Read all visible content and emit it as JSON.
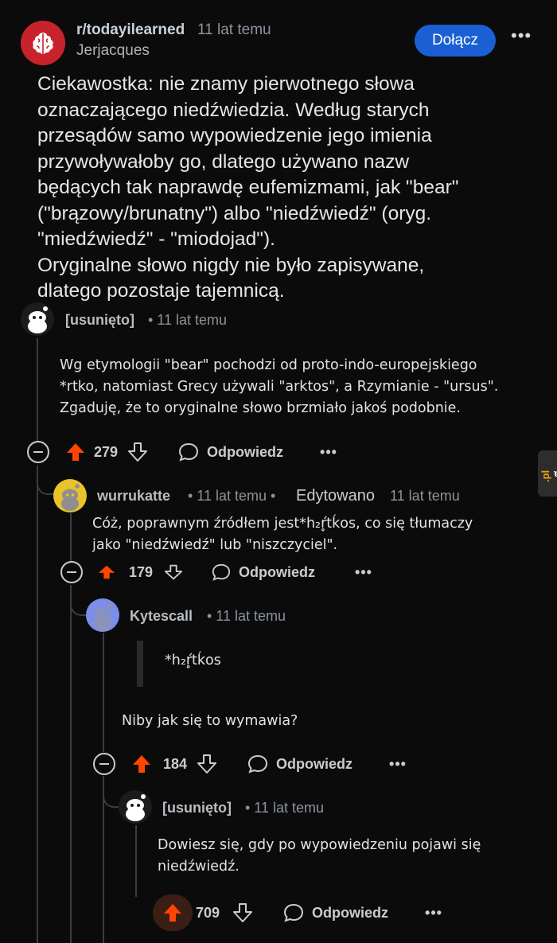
{
  "post": {
    "subreddit": "r/todayilearned",
    "time": "11 lat temu",
    "author": "Jerjacques",
    "join_label": "Dołącz",
    "more": "•••",
    "title": "Ciekawostka: nie znamy pierwotnego słowa\noznaczającego niedźwiedzia. Według starych\nprzesądów samo wypowiedzenie jego imienia\nprzywoływałoby go, dlatego używano nazw\nbędących tak naprawdę eufemizmami, jak \"bear\"\n(\"brązowy/brunatny\") albo \"niedźwiedź\" (oryg.\n\"miedźwiedź\" - \"miodojad\").\nOryginalne słowo nigdy nie było zapisywane,\ndlatego pozostaje tajemnicą."
  },
  "comments": [
    {
      "author": "[usunięto]",
      "meta": "• 11 lat temu",
      "body": "Wg etymologii \"bear\" pochodzi od proto-indo-europejskiego\n*rtko, natomiast Grecy używali \"arktos\", a Rzymianie - \"ursus\".\nZgaduję, że to oryginalne słowo brzmiało jakoś podobnie.",
      "score": "279",
      "reply": "Odpowiedz",
      "more": "•••"
    },
    {
      "author": "wurrukatte",
      "meta": "• 11 lat temu •",
      "edited": "Edytowano",
      "edited_time": "11 lat temu",
      "body": "Cóż, poprawnym źródłem jest*h₂ŕ̥tḱos, co się tłumaczy\njako \"niedźwiedź\" lub \"niszczyciel\".",
      "score": "179",
      "reply": "Odpowiedz",
      "more": "•••"
    },
    {
      "author": "Kytescall",
      "meta": "• 11 lat temu",
      "quote": "*h₂ŕ̥tḱos",
      "body": "Niby jak się to wymawia?",
      "score": "184",
      "reply": "Odpowiedz",
      "more": "•••"
    },
    {
      "author": "[usunięto]",
      "meta": "• 11 lat temu",
      "body": "Dowiesz się, gdy po wypowiedzeniu pojawi się\nniedźwiedź.",
      "score": "709",
      "reply": "Odpowiedz",
      "more": "•••"
    }
  ],
  "watermark": {
    "text": "jeja",
    "suffix": ".pl"
  },
  "colors": {
    "upvote": "#ff4500",
    "join": "#1a5fd4",
    "subreddit_avatar": "#c8232c"
  }
}
